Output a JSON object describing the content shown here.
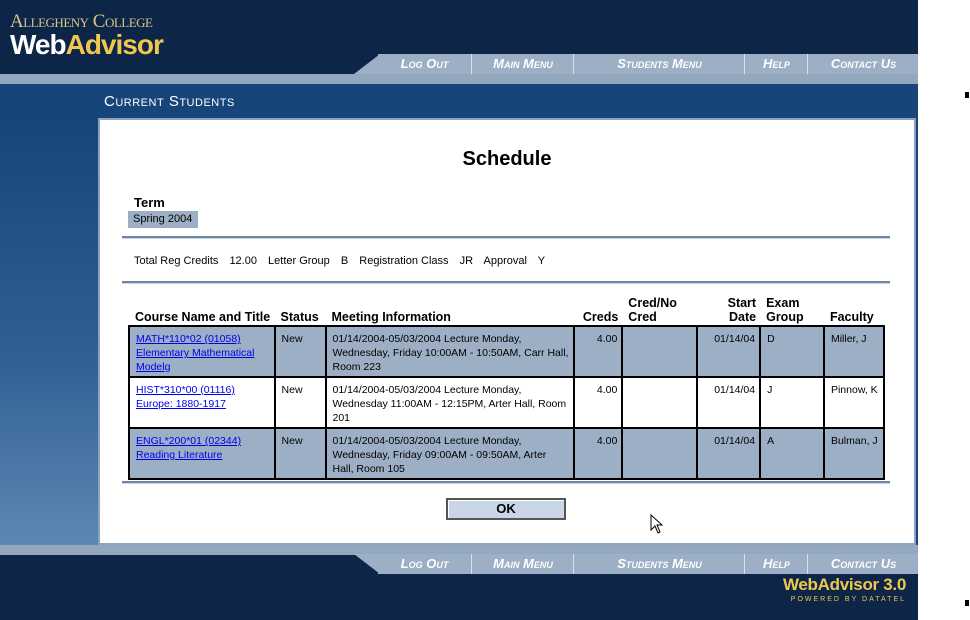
{
  "header": {
    "college": "Allegheny College",
    "app_name_part1": "Web",
    "app_name_part2": "Advisor"
  },
  "nav": {
    "log_out": "Log Out",
    "main_menu": "Main Menu",
    "students_menu": "Students Menu",
    "help": "Help",
    "contact_us": "Contact Us"
  },
  "section_title": "Current Students",
  "page_title": "Schedule",
  "term": {
    "label": "Term",
    "value": "Spring 2004"
  },
  "summary": {
    "total_reg_credits_label": "Total Reg Credits",
    "total_reg_credits_value": "12.00",
    "letter_group_label": "Letter Group",
    "letter_group_value": "B",
    "registration_class_label": "Registration Class",
    "registration_class_value": "JR",
    "approval_label": "Approval",
    "approval_value": "Y"
  },
  "table": {
    "headers": {
      "course": "Course Name and Title",
      "status": "Status",
      "meeting": "Meeting Information",
      "creds": "Creds",
      "cred_no_cred": "Cred/No Cred",
      "start_date": "Start Date",
      "exam_group": "Exam Group",
      "faculty": "Faculty"
    },
    "rows": [
      {
        "course_code": "MATH*110*02 (01058)",
        "course_title": "Elementary Mathematical Modelg",
        "status": "New",
        "meeting": "01/14/2004-05/03/2004 Lecture Monday, Wednesday, Friday 10:00AM - 10:50AM, Carr Hall, Room 223",
        "creds": "4.00",
        "cred_no_cred": "",
        "start_date": "01/14/04",
        "exam_group": "D",
        "faculty": "Miller, J"
      },
      {
        "course_code": "HIST*310*00 (01116)",
        "course_title": "Europe: 1880-1917",
        "status": "New",
        "meeting": "01/14/2004-05/03/2004 Lecture Monday, Wednesday 11:00AM - 12:15PM, Arter Hall, Room 201",
        "creds": "4.00",
        "cred_no_cred": "",
        "start_date": "01/14/04",
        "exam_group": "J",
        "faculty": "Pinnow, K"
      },
      {
        "course_code": "ENGL*200*01 (02344)",
        "course_title": "Reading Literature",
        "status": "New",
        "meeting": "01/14/2004-05/03/2004 Lecture Monday, Wednesday, Friday 09:00AM - 09:50AM, Arter Hall, Room 105",
        "creds": "4.00",
        "cred_no_cred": "",
        "start_date": "01/14/04",
        "exam_group": "A",
        "faculty": "Bulman, J"
      }
    ]
  },
  "ok_button": "OK",
  "footer": {
    "brand": "WebAdvisor 3.0",
    "powered_by": "POWERED BY DATATEL"
  },
  "colors": {
    "navy": "#0d2547",
    "band_blue": "#17457a",
    "row_shade": "#9cafc4",
    "gold": "#f0c850"
  }
}
